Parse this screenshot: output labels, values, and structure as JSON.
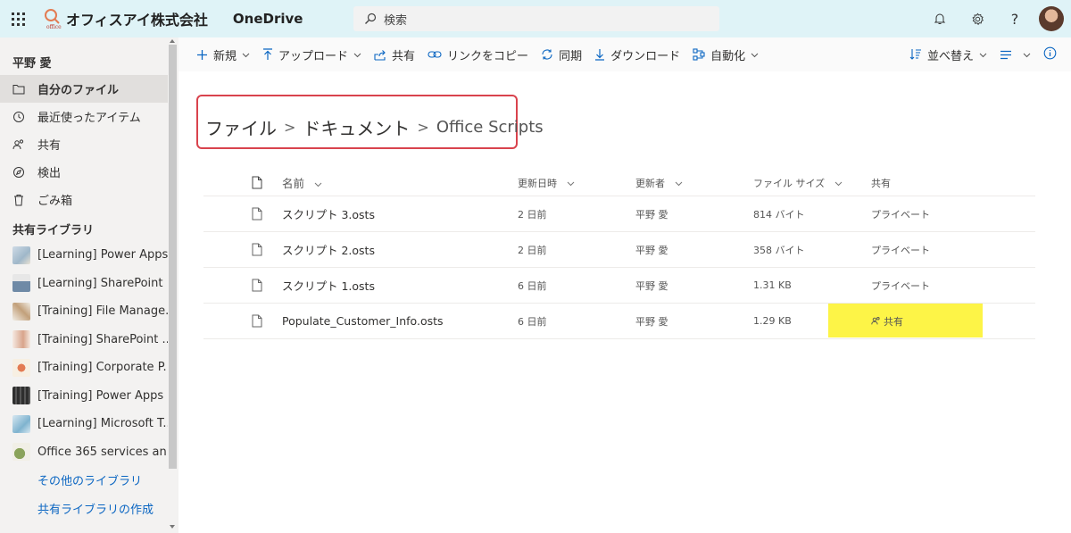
{
  "topbar": {
    "company": "オフィスアイ株式会社",
    "app": "OneDrive",
    "search_placeholder": "検索",
    "icons": [
      "waffle-icon",
      "bell-icon",
      "gear-icon",
      "help-icon"
    ],
    "colors": {
      "background": "#dff3f7"
    }
  },
  "sidebar": {
    "user": "平野 愛",
    "nav": [
      {
        "label": "自分のファイル",
        "icon": "folder-icon",
        "active": true
      },
      {
        "label": "最近使ったアイテム",
        "icon": "clock-icon"
      },
      {
        "label": "共有",
        "icon": "people-icon"
      },
      {
        "label": "検出",
        "icon": "compass-icon"
      },
      {
        "label": "ごみ箱",
        "icon": "trash-icon"
      }
    ],
    "shared_title": "共有ライブラリ",
    "libraries": [
      {
        "label": "[Learning] Power Apps...",
        "color": "#9fb7c9"
      },
      {
        "label": "[Learning] SharePoint ...",
        "color": "#6f8aa6"
      },
      {
        "label": "[Training] File Manage...",
        "color": "#c2a07a"
      },
      {
        "label": "[Training] SharePoint ...",
        "color": "#d8a48b"
      },
      {
        "label": "[Training] Corporate P...",
        "color": "#e3b06b"
      },
      {
        "label": "[Training] Power Apps ...",
        "color": "#2e2e2e"
      },
      {
        "label": "[Learning] Microsoft T...",
        "color": "#7fb3cf"
      },
      {
        "label": "Office 365 services an...",
        "color": "#8aa35a"
      }
    ],
    "links": [
      "その他のライブラリ",
      "共有ライブラリの作成"
    ],
    "colors": {
      "link": "#0b66c2"
    }
  },
  "commands": {
    "new": "新規",
    "upload": "アップロード",
    "share": "共有",
    "copy_link": "リンクをコピー",
    "sync": "同期",
    "download": "ダウンロード",
    "automate": "自動化",
    "sort": "並べ替え"
  },
  "breadcrumb": {
    "items": [
      "ファイル",
      "ドキュメント"
    ],
    "current": "Office Scripts",
    "separator": ">"
  },
  "table": {
    "headers": {
      "name": "名前",
      "modified": "更新日時",
      "modified_by": "更新者",
      "size": "ファイル サイズ",
      "sharing": "共有"
    },
    "rows": [
      {
        "name": "スクリプト 3.osts",
        "modified": "2 日前",
        "modified_by": "平野 愛",
        "size": "814 バイト",
        "sharing": "プライベート",
        "shared": false
      },
      {
        "name": "スクリプト 2.osts",
        "modified": "2 日前",
        "modified_by": "平野 愛",
        "size": "358 バイト",
        "sharing": "プライベート",
        "shared": false
      },
      {
        "name": "スクリプト 1.osts",
        "modified": "6 日前",
        "modified_by": "平野 愛",
        "size": "1.31 KB",
        "sharing": "プライベート",
        "shared": false
      },
      {
        "name": "Populate_Customer_Info.osts",
        "modified": "6 日前",
        "modified_by": "平野 愛",
        "size": "1.29 KB",
        "sharing": "共有",
        "shared": true
      }
    ],
    "colors": {
      "highlight": "#fdf447"
    }
  }
}
